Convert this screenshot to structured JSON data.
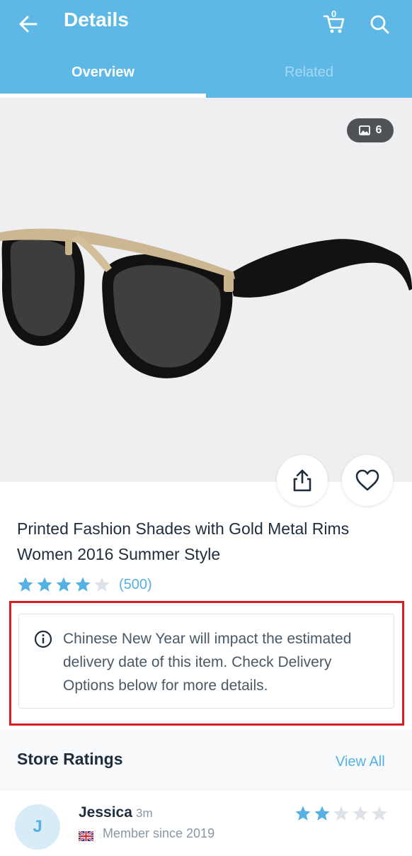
{
  "header": {
    "title": "Details",
    "cart_count": "0",
    "tabs": [
      {
        "label": "Overview",
        "active": true
      },
      {
        "label": "Related",
        "active": false
      }
    ],
    "background": "#5db8e6"
  },
  "gallery": {
    "photo_count": "6"
  },
  "product": {
    "title": "Printed Fashion Shades with Gold Metal Rims Women 2016 Summer Style",
    "rating": 4,
    "rating_count": "(500)"
  },
  "notice": {
    "text": "Chinese New Year will impact the estimated delivery date of this item. Check Delivery Options below for more details."
  },
  "store_ratings": {
    "title": "Store Ratings",
    "view_all": "View All"
  },
  "review": {
    "avatar_initial": "J",
    "name": "Jessica",
    "age": "3m",
    "member_since": "Member since 2019",
    "rating": 2
  },
  "colors": {
    "accent": "#56b1e3",
    "star_filled": "#56b1e3",
    "star_empty": "#dde3e8",
    "highlight_border": "#d81c24"
  }
}
